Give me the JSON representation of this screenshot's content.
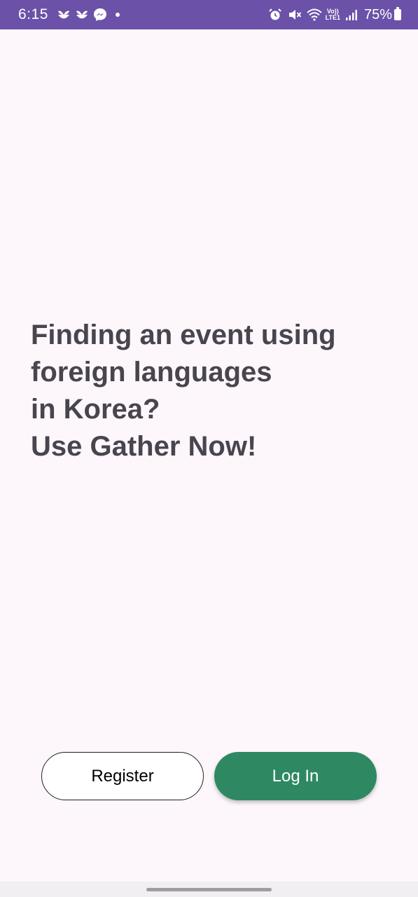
{
  "status_bar": {
    "time": "6:15",
    "left_icons": [
      "sprout-icon",
      "sprout-icon",
      "messenger-icon"
    ],
    "right_icons": [
      "alarm-icon",
      "mute-icon",
      "wifi-icon",
      "lte-icon",
      "signal-icon"
    ],
    "lte_top": "Vo))",
    "lte_bottom": "LTE1",
    "battery": "75%",
    "background": "#6b52a8"
  },
  "headline": {
    "line1": "Finding an event using",
    "line2": "foreign languages",
    "line3": "in Korea?",
    "line4": "Use Gather Now!",
    "color": "#49454f"
  },
  "buttons": {
    "register_label": "Register",
    "login_label": "Log In",
    "login_color": "#2e8963"
  }
}
